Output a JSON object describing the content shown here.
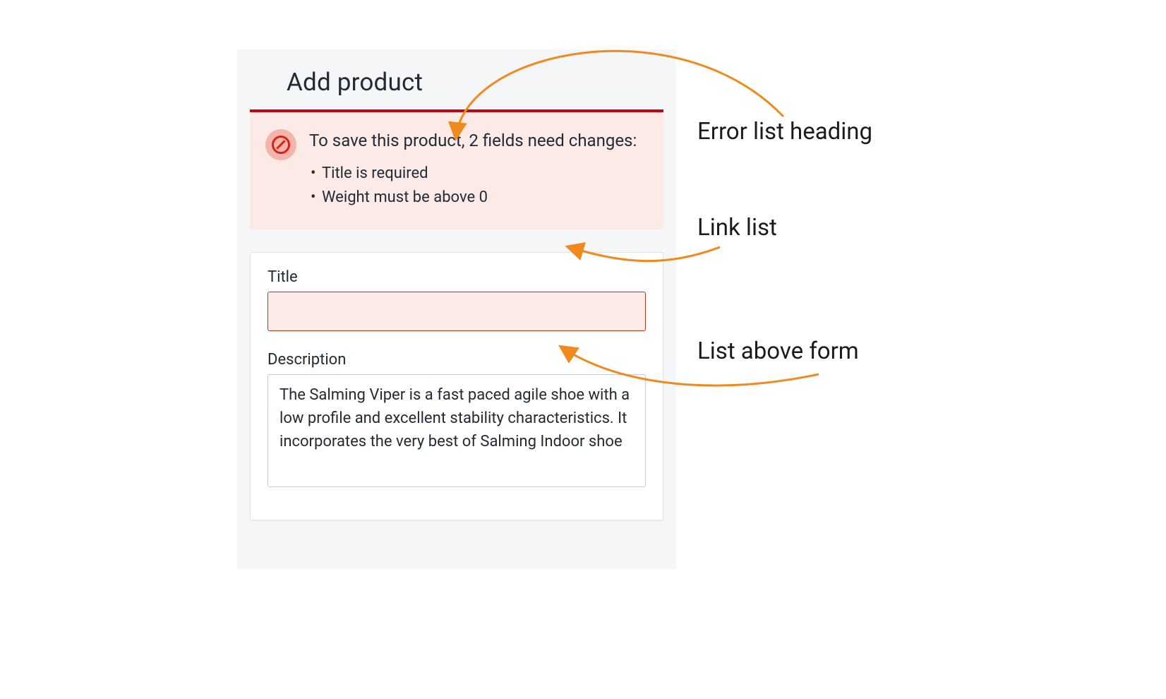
{
  "page": {
    "title": "Add product"
  },
  "error_banner": {
    "heading": "To save this product, 2 fields need changes:",
    "items": [
      "Title is required",
      "Weight must be above 0"
    ]
  },
  "form": {
    "title": {
      "label": "Title",
      "value": ""
    },
    "description": {
      "label": "Description",
      "value": "The Salming Viper is a fast paced agile shoe with a low profile and excellent stability characteristics. It incorporates the very best of Salming Indoor shoe"
    }
  },
  "annotations": {
    "a1": "Error list heading",
    "a2": "Link list",
    "a3": "List above form"
  },
  "colors": {
    "error_border": "#bf0711",
    "error_bg": "#fbeae6",
    "arrow": "#f08a1c"
  }
}
